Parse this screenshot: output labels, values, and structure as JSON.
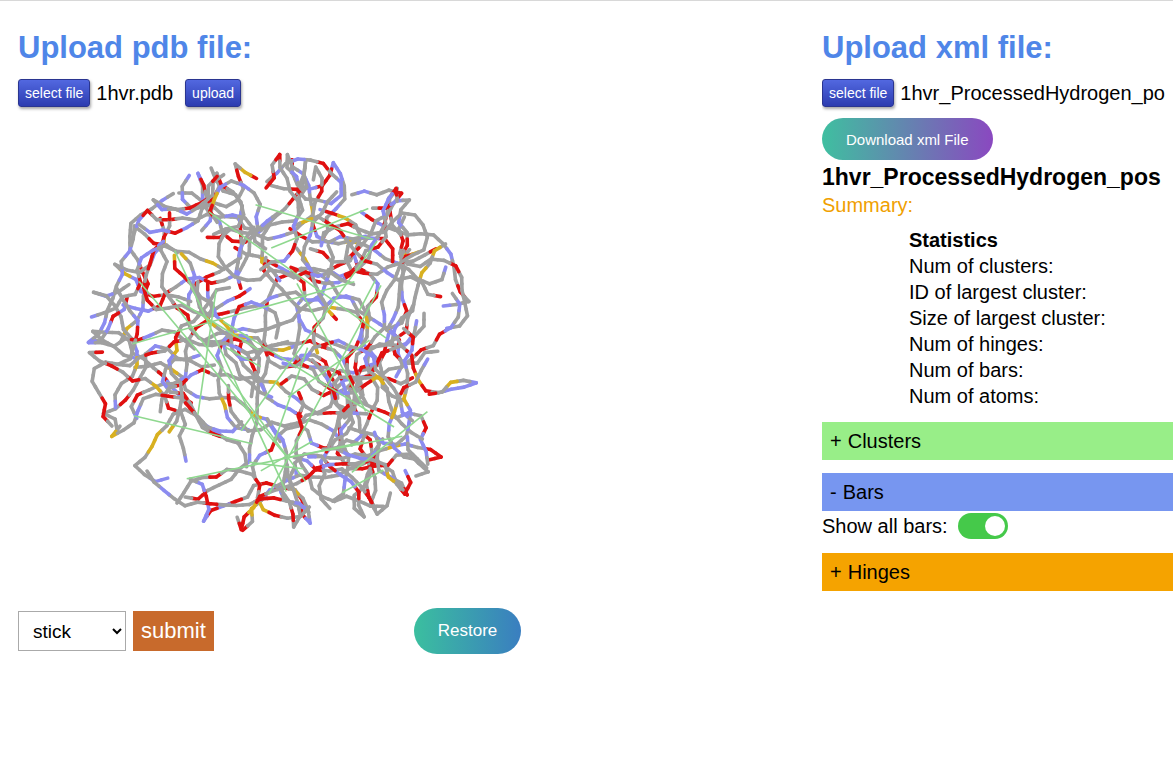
{
  "pdb_panel": {
    "title": "Upload pdb file:",
    "select_button": "select file",
    "file_name": "1hvr.pdb",
    "upload_button": "upload"
  },
  "viewer": {
    "style_select": {
      "value": "stick"
    },
    "submit_button": "submit",
    "restore_button": "Restore"
  },
  "xml_panel": {
    "title": "Upload xml file:",
    "select_button": "select file",
    "file_name": "1hvr_ProcessedHydrogen_po",
    "download_button": "Download xml File",
    "document_title": "1hvr_ProcessedHydrogen_pos",
    "summary_label": "Summary:",
    "statistics": {
      "title": "Statistics",
      "rows": [
        "Num of clusters:",
        "ID of largest cluster:",
        "Size of largest cluster:",
        "Num of hinges:",
        "Num of bars:",
        "Num of atoms:"
      ]
    },
    "sections": [
      {
        "toggle": "+",
        "label": "Clusters",
        "expanded": false,
        "color": "#98ee88"
      },
      {
        "toggle": "-",
        "label": "Bars",
        "expanded": true,
        "color": "#7796f0",
        "switch": {
          "label": "Show all bars:",
          "on": true
        }
      },
      {
        "toggle": "+",
        "label": "Hinges",
        "expanded": false,
        "color": "#f5a300"
      }
    ]
  }
}
